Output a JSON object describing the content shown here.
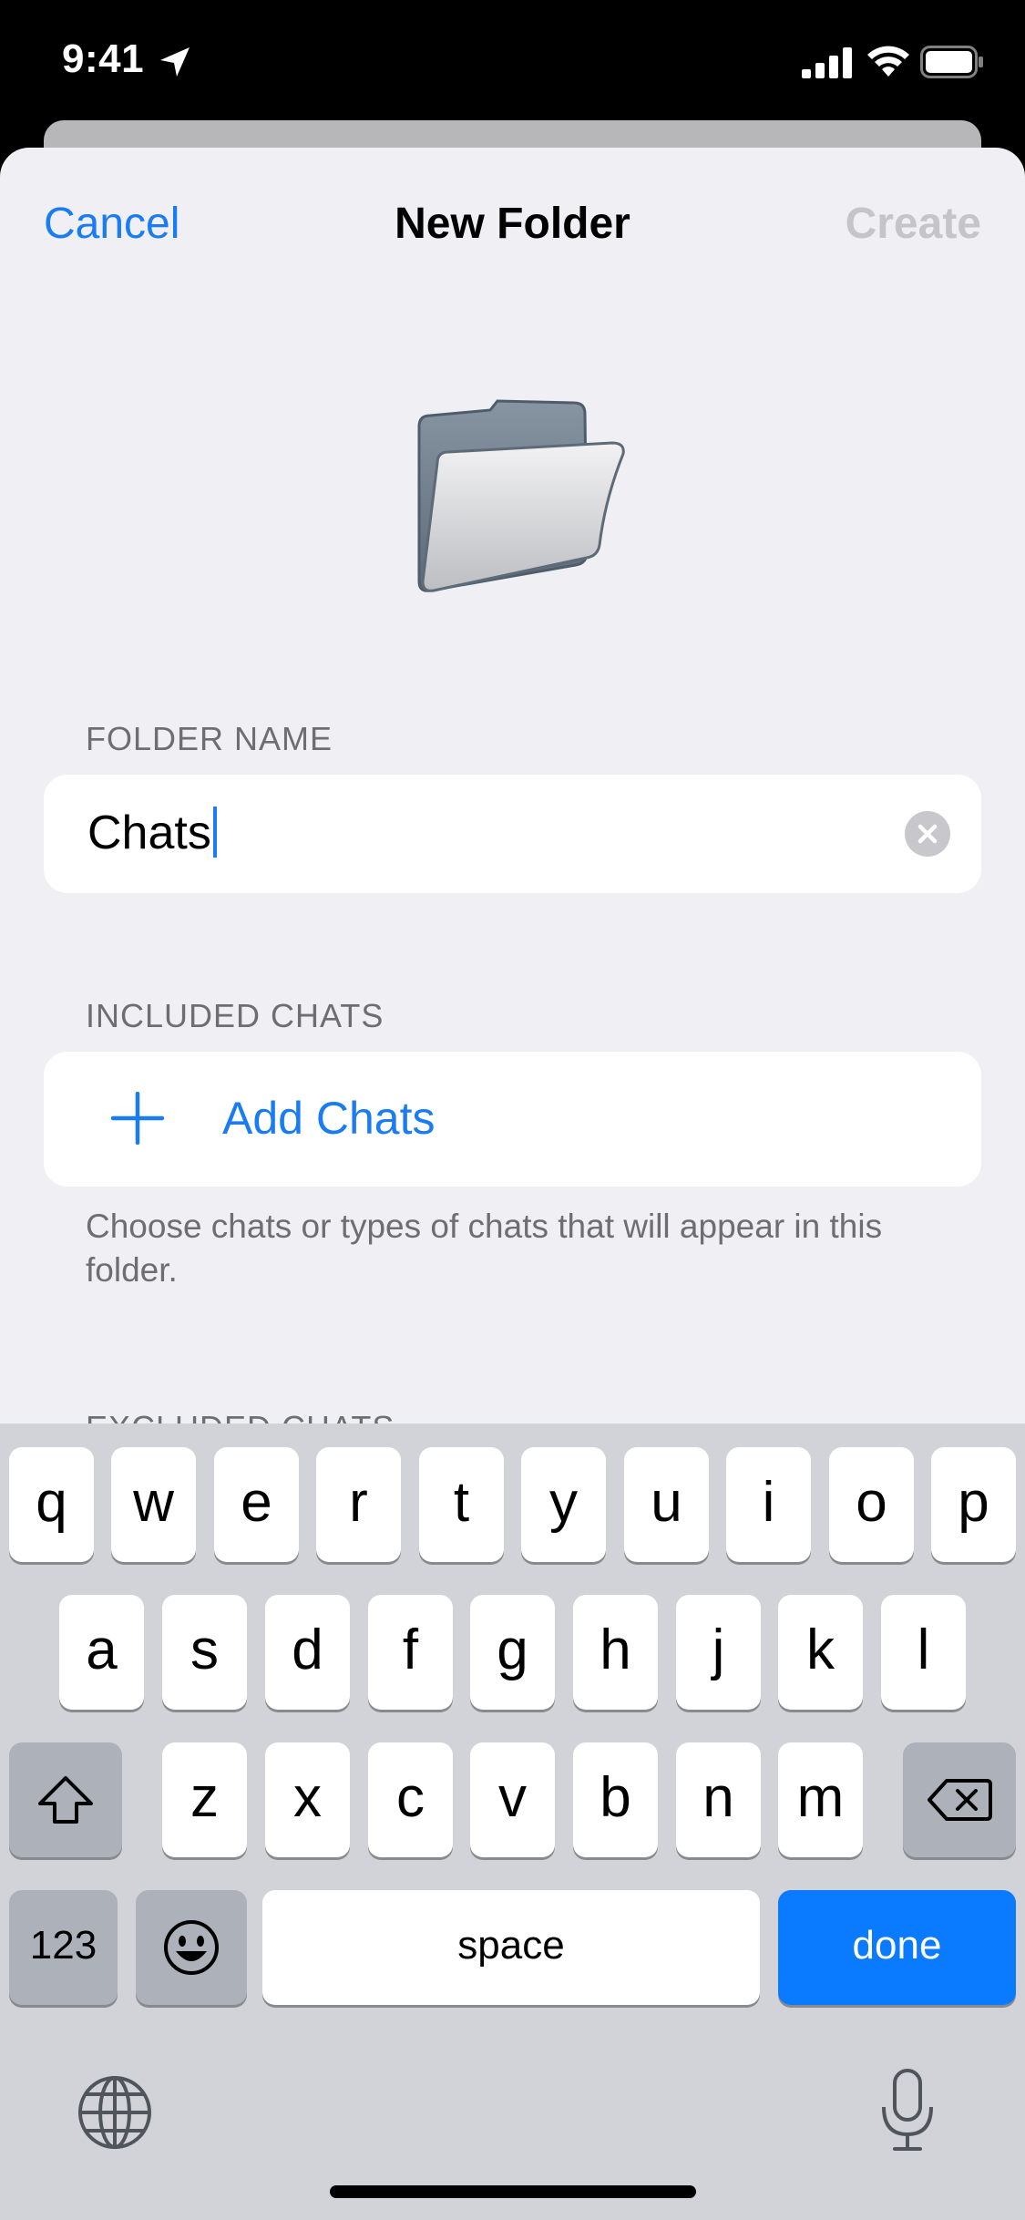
{
  "status_bar": {
    "time": "9:41"
  },
  "nav": {
    "cancel": "Cancel",
    "title": "New Folder",
    "create": "Create"
  },
  "folder_name": {
    "header": "FOLDER NAME",
    "value": "Chats"
  },
  "included_chats": {
    "header": "INCLUDED CHATS",
    "add_label": "Add Chats",
    "footer": "Choose chats or types of chats that will appear in this folder."
  },
  "excluded_chats": {
    "header": "EXCLUDED CHATS"
  },
  "keyboard": {
    "row1": [
      "q",
      "w",
      "e",
      "r",
      "t",
      "y",
      "u",
      "i",
      "o",
      "p"
    ],
    "row2": [
      "a",
      "s",
      "d",
      "f",
      "g",
      "h",
      "j",
      "k",
      "l"
    ],
    "row3": [
      "z",
      "x",
      "c",
      "v",
      "b",
      "n",
      "m"
    ],
    "numbers_label": "123",
    "space_label": "space",
    "done_label": "done"
  },
  "colors": {
    "accent": "#1a7cf2",
    "done_key": "#0a7aff",
    "background": "#efeff4"
  }
}
